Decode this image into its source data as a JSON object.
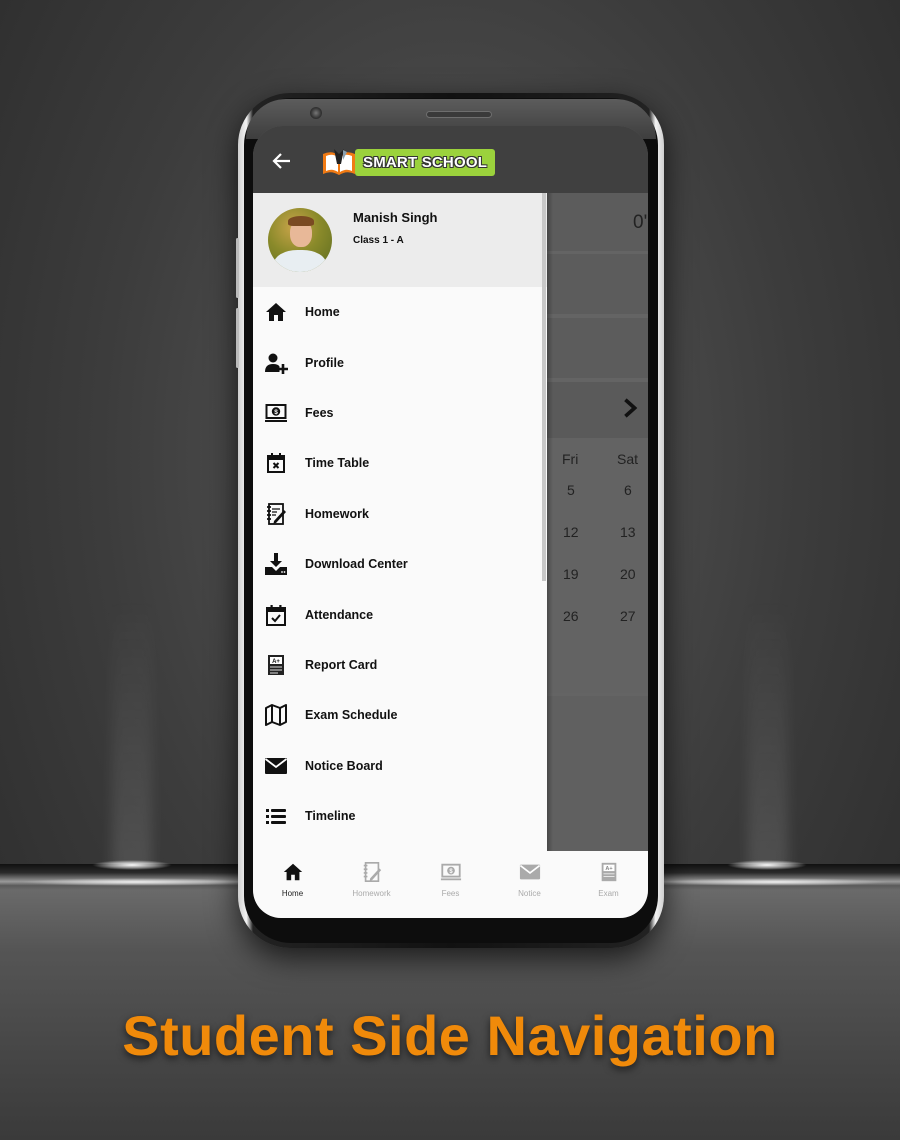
{
  "app": {
    "brand": "SMART SCHOOL",
    "back_icon": "arrow-left-icon"
  },
  "user": {
    "name": "Manish Singh",
    "class": "Class 1 - A"
  },
  "menu": [
    {
      "label": "Home",
      "icon": "home-icon"
    },
    {
      "label": "Profile",
      "icon": "user-plus-icon"
    },
    {
      "label": "Fees",
      "icon": "fees-laptop-dollar-icon"
    },
    {
      "label": "Time Table",
      "icon": "calendar-x-icon"
    },
    {
      "label": "Homework",
      "icon": "notebook-pen-icon"
    },
    {
      "label": "Download Center",
      "icon": "download-icon"
    },
    {
      "label": "Attendance",
      "icon": "calendar-check-icon"
    },
    {
      "label": "Report Card",
      "icon": "report-card-icon"
    },
    {
      "label": "Exam Schedule",
      "icon": "map-icon"
    },
    {
      "label": "Notice Board",
      "icon": "envelope-icon"
    },
    {
      "label": "Timeline",
      "icon": "list-icon"
    }
  ],
  "background": {
    "partial_value": "0'",
    "next_icon": "chevron-right-icon",
    "weekdays": [
      "Fri",
      "Sat"
    ],
    "weeks": [
      [
        "5",
        "6"
      ],
      [
        "12",
        "13"
      ],
      [
        "19",
        "20"
      ],
      [
        "26",
        "27"
      ]
    ]
  },
  "bottom_nav": [
    {
      "label": "Home",
      "icon": "home-icon",
      "active": true
    },
    {
      "label": "Homework",
      "icon": "notebook-pen-icon",
      "active": false
    },
    {
      "label": "Fees",
      "icon": "fees-laptop-dollar-icon",
      "active": false
    },
    {
      "label": "Notice",
      "icon": "envelope-icon",
      "active": false
    },
    {
      "label": "Exam",
      "icon": "report-card-icon",
      "active": false
    }
  ],
  "caption": "Student Side Navigation",
  "colors": {
    "caption": "#f08a0a",
    "brand_green": "#9bd23c",
    "topbar": "#404040"
  }
}
